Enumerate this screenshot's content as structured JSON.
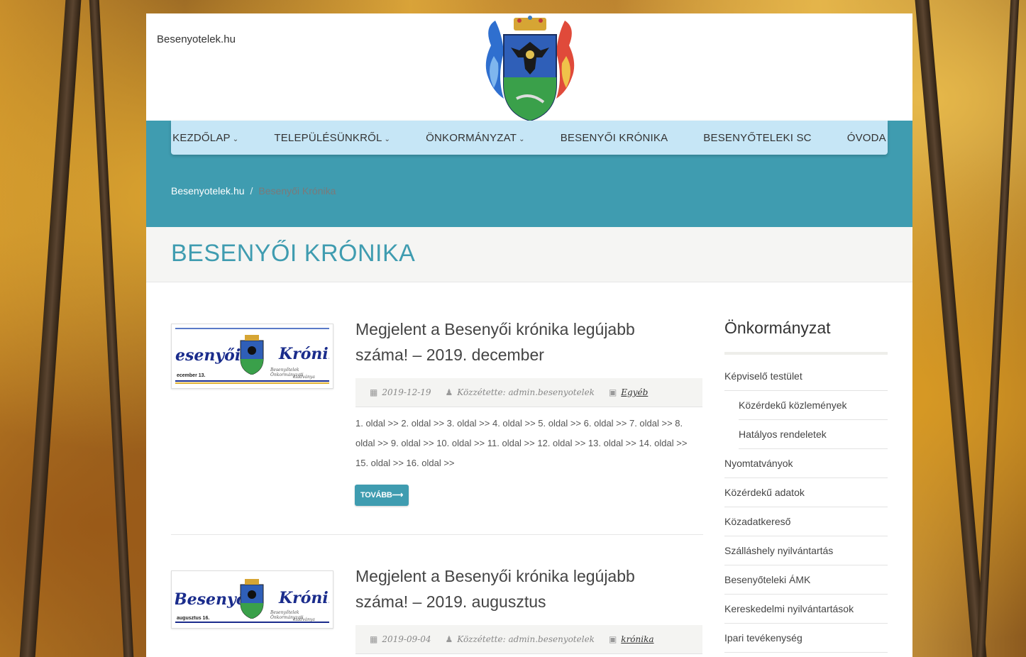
{
  "site": {
    "name": "Besenyotelek.hu"
  },
  "nav": {
    "items": [
      {
        "label": "KEZDŐLAP",
        "dropdown": true
      },
      {
        "label": "TELEPÜLÉSÜNKRŐL",
        "dropdown": true
      },
      {
        "label": "ÖNKORMÁNYZAT",
        "dropdown": true
      },
      {
        "label": "BESENYŐI KRÓNIKA",
        "dropdown": false
      },
      {
        "label": "BESENYŐTELEKI SC",
        "dropdown": false
      },
      {
        "label": "ÓVODA",
        "dropdown": false
      }
    ]
  },
  "breadcrumb": {
    "home": "Besenyotelek.hu",
    "separator": "/",
    "current": "Besenyői Krónika"
  },
  "page_title": "BESENYŐI KRÓNIKA",
  "posts": [
    {
      "title_line1": "Megjelent a Besenyői krónika legújabb",
      "title_line2": "száma! – 2019. december",
      "date": "2019-12-19",
      "author": "Közzétette: admin.besenyotelek",
      "category": "Egyéb",
      "excerpt_line1": "1. oldal >> 2. oldal >> 3. oldal >> 4. oldal >> 5. oldal >> 6. oldal >> 7. oldal >> 8.",
      "excerpt_line2": "oldal >> 9. oldal >> 10. oldal >> 11. oldal >> 12. oldal >> 13. oldal >> 14. oldal >>",
      "excerpt_line3": "15. oldal >> 16. oldal >>",
      "more_label": "TOVÁBB⟶",
      "thumb": {
        "left_word": "esenyői",
        "right_word": "Krónik",
        "date": "ecember 13.",
        "sub": "Besenyőtelek Önkormányzati",
        "sub2": "kiadványa"
      }
    },
    {
      "title_line1": "Megjelent a Besenyői krónika legújabb",
      "title_line2": "száma! – 2019. augusztus",
      "date": "2019-09-04",
      "author": "Közzétette: admin.besenyotelek",
      "category": "krónika",
      "thumb": {
        "left_word": "Besenyői",
        "right_word": "Krónik",
        "date": "augusztus 16.",
        "sub": "Besenyőtelek Önkormányzati",
        "sub2": "kiadványa"
      }
    }
  ],
  "sidebar": {
    "title": "Önkormányzat",
    "items": [
      {
        "label": "Képviselő testület",
        "sub": false
      },
      {
        "label": "Közérdekű közlemények",
        "sub": true
      },
      {
        "label": "Hatályos rendeletek",
        "sub": true
      },
      {
        "label": "Nyomtatványok",
        "sub": false
      },
      {
        "label": "Közérdekű adatok",
        "sub": false
      },
      {
        "label": "Közadatkereső",
        "sub": false
      },
      {
        "label": "Szálláshely nyilvántartás",
        "sub": false
      },
      {
        "label": "Besenyőteleki ÁMK",
        "sub": false
      },
      {
        "label": "Kereskedelmi nyilvántartások",
        "sub": false
      },
      {
        "label": "Ipari tevékenység",
        "sub": false
      }
    ]
  },
  "colors": {
    "teal": "#3f9cb0",
    "nav_bg": "#c6e6f6"
  }
}
